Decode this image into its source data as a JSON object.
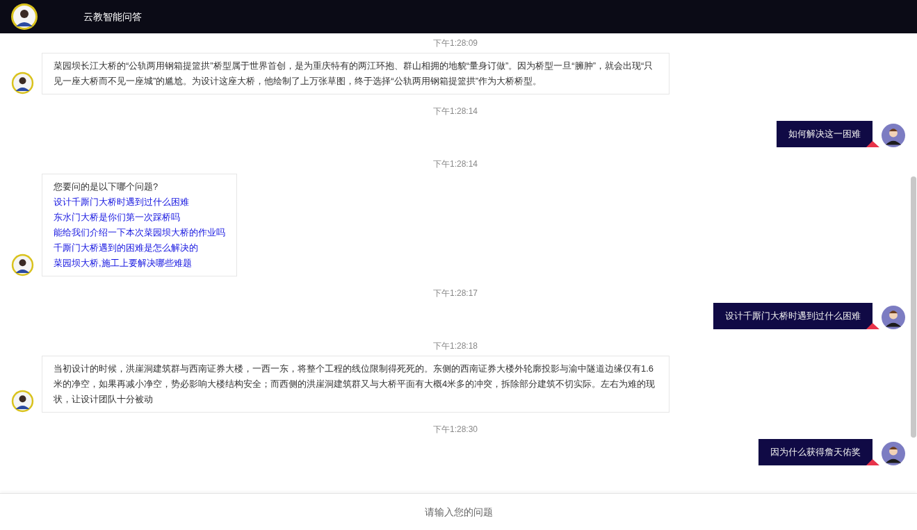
{
  "header": {
    "title": "云教智能问答"
  },
  "messages": [
    {
      "time": "下午1:28:09",
      "kind": "bot",
      "text": "菜园坝长江大桥的“公轨两用钢箱提篮拱”桥型属于世界首创，是为重庆特有的两江环抱、群山相拥的地貌“量身订做”。因为桥型一旦“臃肿”，就会出现“只见一座大桥而不见一座城”的尴尬。为设计这座大桥，他绘制了上万张草图，终于选择“公轨两用钢箱提篮拱”作为大桥桥型。"
    },
    {
      "time": "下午1:28:14",
      "kind": "user",
      "text": "如何解决这一困难"
    },
    {
      "time": "下午1:28:14",
      "kind": "bot",
      "text": "您要问的是以下哪个问题?",
      "options": [
        "设计千厮门大桥时遇到过什么困难",
        "东水门大桥是你们第一次踩桥吗",
        "能给我们介绍一下本次菜园坝大桥的作业吗",
        "千厮门大桥遇到的困难是怎么解决的",
        "菜园坝大桥,施工上要解决哪些难题"
      ]
    },
    {
      "time": "下午1:28:17",
      "kind": "user",
      "text": "设计千厮门大桥时遇到过什么困难"
    },
    {
      "time": "下午1:28:18",
      "kind": "bot",
      "text": "当初设计的时候，洪崖洞建筑群与西南证券大楼，一西一东，将整个工程的线位限制得死死的。东侧的西南证券大楼外轮廓投影与渝中隧道边缘仅有1.6米的净空，如果再减小净空，势必影响大楼结构安全；而西侧的洪崖洞建筑群又与大桥平面有大概4米多的冲突，拆除部分建筑不切实际。左右为难的现状，让设计团队十分被动"
    },
    {
      "time": "下午1:28:30",
      "kind": "user",
      "text": "因为什么获得詹天佑奖"
    }
  ],
  "input": {
    "placeholder": "请输入您的问题"
  }
}
